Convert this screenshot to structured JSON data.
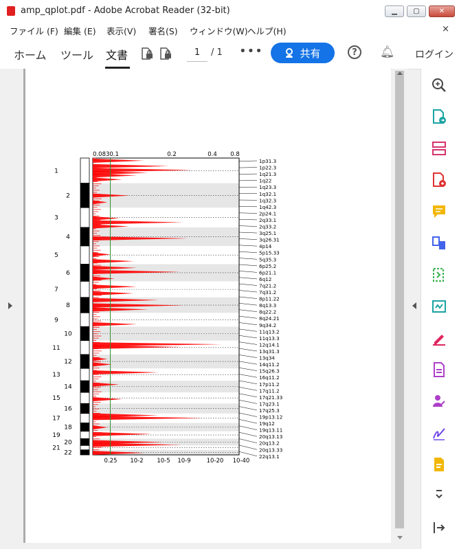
{
  "window": {
    "title": "amp_qplot.pdf - Adobe Acrobat Reader (32-bit)",
    "minimize_glyph": "▁",
    "maximize_glyph": "▢",
    "close_glyph": "✕"
  },
  "menu": {
    "items": [
      "ファイル (F)",
      "編集 (E)",
      "表示(V)",
      "署名(S)",
      "ウィンドウ(W)",
      "ヘルプ(H)"
    ],
    "close_glyph": "×"
  },
  "toolbar": {
    "tabs": [
      "ホーム",
      "ツール",
      "文書"
    ],
    "active_tab": "文書",
    "page_current": "1",
    "page_total": "/ 1",
    "more_glyph": "•••",
    "share_label": "共有",
    "help_glyph": "?",
    "login_label": "ログイン"
  },
  "side_tools": [
    "zoom-search-icon",
    "export-pdf-icon",
    "organize-pages-icon",
    "create-pdf-icon",
    "comment-icon",
    "combine-files-icon",
    "compress-pdf-icon",
    "fill-sign-icon",
    "edit-pdf-icon",
    "request-signature-icon",
    "send-for-signature-icon",
    "sign-pen-icon",
    "protect-icon",
    "more-tools-icon",
    "collapse-panel-icon"
  ],
  "chart_data": {
    "type": "line",
    "top_axis_ticks": [
      "0.0830.1",
      "0.2",
      "0.4",
      "0.8"
    ],
    "bottom_axis_ticks": [
      "0.25",
      "10^-2",
      "10^-5",
      "10^-9",
      "10^-20",
      "10^-40"
    ],
    "chromosomes": [
      "1",
      "2",
      "3",
      "4",
      "5",
      "6",
      "7",
      "8",
      "9",
      "10",
      "11",
      "12",
      "13",
      "14",
      "15",
      "16",
      "17",
      "18",
      "19",
      "20",
      "21",
      "22"
    ],
    "chromosome_spans": [
      [
        0,
        18.8
      ],
      [
        18.8,
        37
      ],
      [
        37,
        51.8
      ],
      [
        51.8,
        65.6
      ],
      [
        65.6,
        79.2
      ],
      [
        79.2,
        92
      ],
      [
        92,
        104
      ],
      [
        104,
        115.5
      ],
      [
        115.5,
        125.8
      ],
      [
        125.8,
        136.2
      ],
      [
        136.2,
        146.6
      ],
      [
        146.6,
        157
      ],
      [
        157,
        166.2
      ],
      [
        166.2,
        174.9
      ],
      [
        174.9,
        183.2
      ],
      [
        183.2,
        190.6
      ],
      [
        190.6,
        197.7
      ],
      [
        197.7,
        203.9
      ],
      [
        203.9,
        209.4
      ],
      [
        209.4,
        214.5
      ],
      [
        214.5,
        217.8
      ],
      [
        217.8,
        221.5
      ]
    ],
    "cytoband_labels": [
      "1p31.3",
      "1p22.3",
      "1q21.3",
      "1q22",
      "1q23.3",
      "1q32.1",
      "1q32.3",
      "1q42.3",
      "2p24.1",
      "2q33.1",
      "2q33.2",
      "3q25.1",
      "3q26.31",
      "4p14",
      "5p15.33",
      "5q35.3",
      "6p25.2",
      "6p21.1",
      "6q12",
      "7q21.2",
      "7q31.2",
      "8p11.22",
      "8q13.3",
      "8q22.2",
      "8q24.21",
      "9q34.2",
      "11q13.2",
      "11q13.3",
      "12q14.1",
      "13q31.3",
      "13q34",
      "14q11.2",
      "15q26.3",
      "16q11.2",
      "17p11.2",
      "17q11.2",
      "17q21.33",
      "17q23.1",
      "17q25.3",
      "19p13.12",
      "19q12",
      "19q13.11",
      "20q13.13",
      "20q13.2",
      "20q13.33",
      "22q13.1"
    ],
    "peaks": [
      {
        "chr": "1",
        "pos": 2,
        "x": 0.35
      },
      {
        "chr": "1",
        "pos": 6,
        "x": 0.52
      },
      {
        "chr": "1",
        "pos": 9,
        "x": 0.68
      },
      {
        "chr": "1",
        "pos": 11,
        "x": 0.38
      },
      {
        "chr": "1",
        "pos": 13,
        "x": 0.3
      },
      {
        "chr": "1",
        "pos": 16,
        "x": 0.2
      },
      {
        "chr": "2",
        "pos": 28,
        "x": 0.25
      },
      {
        "chr": "2",
        "pos": 33,
        "x": 0.1
      },
      {
        "chr": "3",
        "pos": 45,
        "x": 0.18
      },
      {
        "chr": "3",
        "pos": 48,
        "x": 0.62
      },
      {
        "chr": "3",
        "pos": 51,
        "x": 0.25
      },
      {
        "chr": "4",
        "pos": 60,
        "x": 0.65
      },
      {
        "chr": "5",
        "pos": 72,
        "x": 0.12
      },
      {
        "chr": "5",
        "pos": 77,
        "x": 0.28
      },
      {
        "chr": "6",
        "pos": 82,
        "x": 0.3
      },
      {
        "chr": "6",
        "pos": 85,
        "x": 0.6
      },
      {
        "chr": "6",
        "pos": 90,
        "x": 0.15
      },
      {
        "chr": "7",
        "pos": 96,
        "x": 0.3
      },
      {
        "chr": "7",
        "pos": 101,
        "x": 0.28
      },
      {
        "chr": "8",
        "pos": 106,
        "x": 0.45
      },
      {
        "chr": "8",
        "pos": 110,
        "x": 0.62
      },
      {
        "chr": "8",
        "pos": 113,
        "x": 0.38
      },
      {
        "chr": "9",
        "pos": 124,
        "x": 0.3
      },
      {
        "chr": "11",
        "pos": 139,
        "x": 0.88
      },
      {
        "chr": "11",
        "pos": 141,
        "x": 0.6
      },
      {
        "chr": "12",
        "pos": 150,
        "x": 0.1
      },
      {
        "chr": "12",
        "pos": 154,
        "x": 0.13
      },
      {
        "chr": "13",
        "pos": 160,
        "x": 0.45
      },
      {
        "chr": "14",
        "pos": 169,
        "x": 0.18
      },
      {
        "chr": "15",
        "pos": 180,
        "x": 0.2
      },
      {
        "chr": "17",
        "pos": 192,
        "x": 0.45
      },
      {
        "chr": "17",
        "pos": 194,
        "x": 0.75
      },
      {
        "chr": "18",
        "pos": 201,
        "x": 0.1
      },
      {
        "chr": "19",
        "pos": 206,
        "x": 0.4
      },
      {
        "chr": "20",
        "pos": 212,
        "x": 0.48
      },
      {
        "chr": "20",
        "pos": 214,
        "x": 0.6
      },
      {
        "chr": "22",
        "pos": 220,
        "x": 0.35
      }
    ],
    "threshold_line_x": 0.083,
    "peak_color": "#ff0000",
    "threshold_color": "#2e8b2e"
  }
}
